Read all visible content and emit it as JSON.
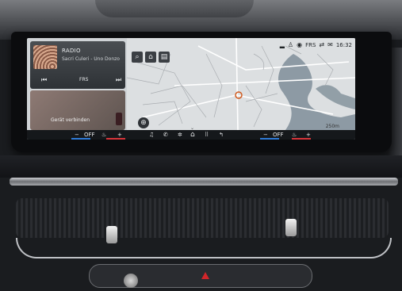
{
  "status": {
    "station": "FRS",
    "time": "16:32"
  },
  "map": {
    "tools": [
      {
        "icon": "search-icon",
        "glyph": "⌕"
      },
      {
        "icon": "poi-icon",
        "glyph": "⌂"
      },
      {
        "icon": "map-layers-icon",
        "glyph": "▤"
      }
    ],
    "scale_label": "250m"
  },
  "radio": {
    "title": "RADIO",
    "subtitle": "Sacri Culeri - Uno Donzo",
    "station": "FRS"
  },
  "phone": {
    "label": "Gerät verbinden"
  },
  "climate": {
    "left_temp": "OFF",
    "right_temp": "OFF",
    "minus": "−",
    "plus": "+"
  },
  "colors": {
    "accent_blue": "#2e7bd9",
    "accent_red": "#d8353a",
    "nav_orange": "#d05a1e"
  }
}
